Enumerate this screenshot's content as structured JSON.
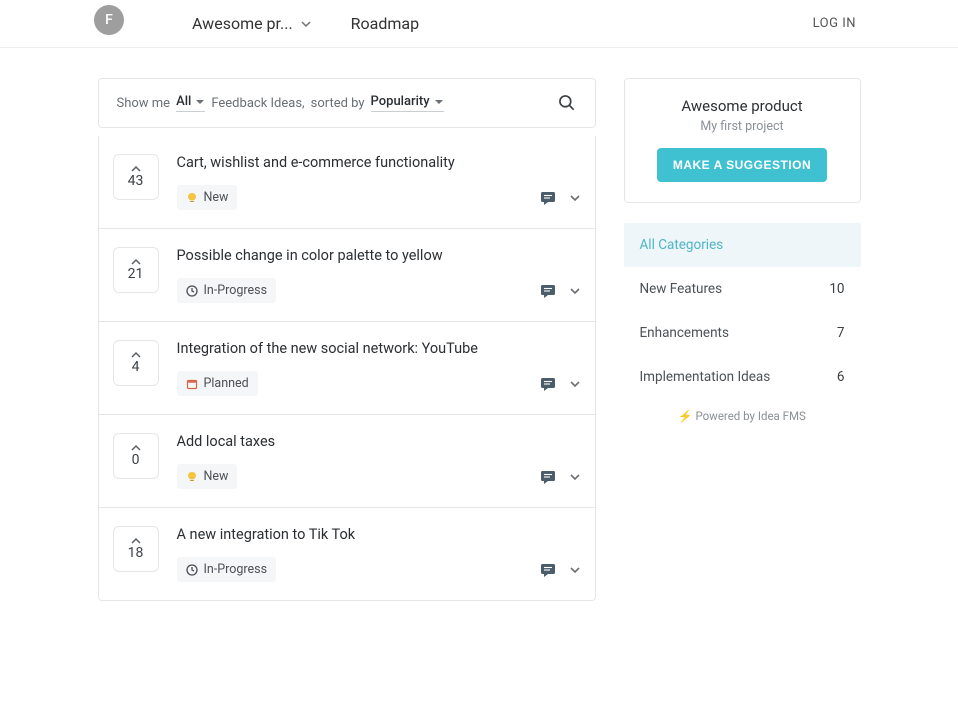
{
  "header": {
    "avatar_letter": "F",
    "project_label": "Awesome pr...",
    "nav_roadmap": "Roadmap",
    "login": "LOG IN"
  },
  "filter": {
    "show_me": "Show me",
    "all": "All",
    "feedback_ideas": "Feedback Ideas,",
    "sorted_by": "sorted by",
    "popularity": "Popularity"
  },
  "items": [
    {
      "votes": "43",
      "title": "Cart, wishlist and e-commerce functionality",
      "status": "New",
      "status_kind": "new"
    },
    {
      "votes": "21",
      "title": "Possible change in color palette to yellow",
      "status": "In-Progress",
      "status_kind": "progress"
    },
    {
      "votes": "4",
      "title": "Integration of the new social network: YouTube",
      "status": "Planned",
      "status_kind": "planned"
    },
    {
      "votes": "0",
      "title": "Add local taxes",
      "status": "New",
      "status_kind": "new"
    },
    {
      "votes": "18",
      "title": "A new integration to Tik Tok",
      "status": "In-Progress",
      "status_kind": "progress"
    }
  ],
  "sidebar": {
    "title": "Awesome product",
    "subtitle": "My first project",
    "cta": "MAKE A SUGGESTION",
    "all_categories": "All Categories",
    "categories": [
      {
        "name": "New Features",
        "count": "10"
      },
      {
        "name": "Enhancements",
        "count": "7"
      },
      {
        "name": "Implementation Ideas",
        "count": "6"
      }
    ],
    "powered": "Powered by Idea FMS"
  }
}
